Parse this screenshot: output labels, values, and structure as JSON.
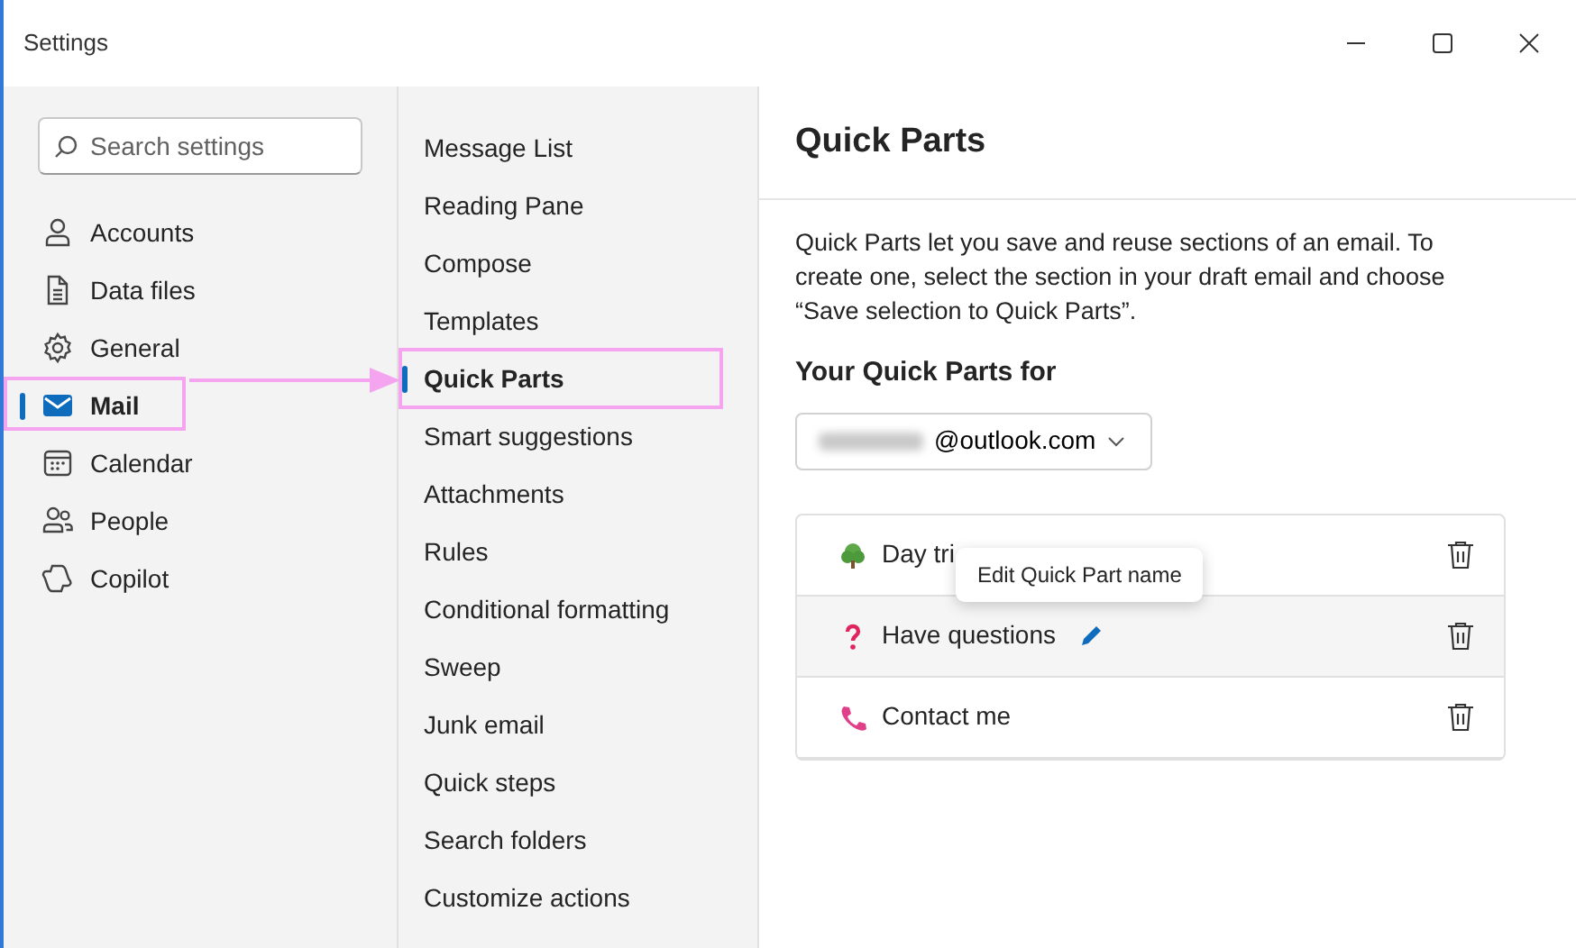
{
  "window": {
    "title": "Settings"
  },
  "search": {
    "placeholder": "Search settings"
  },
  "sidebar": {
    "items": [
      {
        "label": "Accounts",
        "kind": "person",
        "selected": false,
        "highlighted": false
      },
      {
        "label": "Data files",
        "kind": "document",
        "selected": false,
        "highlighted": false
      },
      {
        "label": "General",
        "kind": "gear",
        "selected": false,
        "highlighted": false
      },
      {
        "label": "Mail",
        "kind": "mail",
        "selected": true,
        "highlighted": true
      },
      {
        "label": "Calendar",
        "kind": "calendar",
        "selected": false,
        "highlighted": false
      },
      {
        "label": "People",
        "kind": "people",
        "selected": false,
        "highlighted": false
      },
      {
        "label": "Copilot",
        "kind": "copilot",
        "selected": false,
        "highlighted": false
      }
    ]
  },
  "subnav": {
    "items": [
      {
        "label": "Message List",
        "selected": false,
        "highlighted": false
      },
      {
        "label": "Reading Pane",
        "selected": false,
        "highlighted": false
      },
      {
        "label": "Compose",
        "selected": false,
        "highlighted": false
      },
      {
        "label": "Templates",
        "selected": false,
        "highlighted": false
      },
      {
        "label": "Quick Parts",
        "selected": true,
        "highlighted": true
      },
      {
        "label": "Smart suggestions",
        "selected": false,
        "highlighted": false
      },
      {
        "label": "Attachments",
        "selected": false,
        "highlighted": false
      },
      {
        "label": "Rules",
        "selected": false,
        "highlighted": false
      },
      {
        "label": "Conditional formatting",
        "selected": false,
        "highlighted": false
      },
      {
        "label": "Sweep",
        "selected": false,
        "highlighted": false
      },
      {
        "label": "Junk email",
        "selected": false,
        "highlighted": false
      },
      {
        "label": "Quick steps",
        "selected": false,
        "highlighted": false
      },
      {
        "label": "Search folders",
        "selected": false,
        "highlighted": false
      },
      {
        "label": "Customize actions",
        "selected": false,
        "highlighted": false
      }
    ]
  },
  "callout_arrow": true,
  "content": {
    "title": "Quick Parts",
    "description": "Quick Parts let you save and reuse sections of an email. To create one, select the section in your draft email and choose “Save selection to Quick Parts”.",
    "section_title": "Your Quick Parts for",
    "account": {
      "value": "@outlook.com",
      "blurred": true
    },
    "quick_parts": [
      {
        "name": "Day tri",
        "kind": "tree",
        "hovered": false,
        "editing": false
      },
      {
        "name": "Have questions",
        "kind": "question",
        "hovered": true,
        "editing": true
      },
      {
        "name": "Contact me",
        "kind": "phone",
        "hovered": false,
        "editing": false
      }
    ],
    "tooltip": "Edit Quick Part name"
  }
}
